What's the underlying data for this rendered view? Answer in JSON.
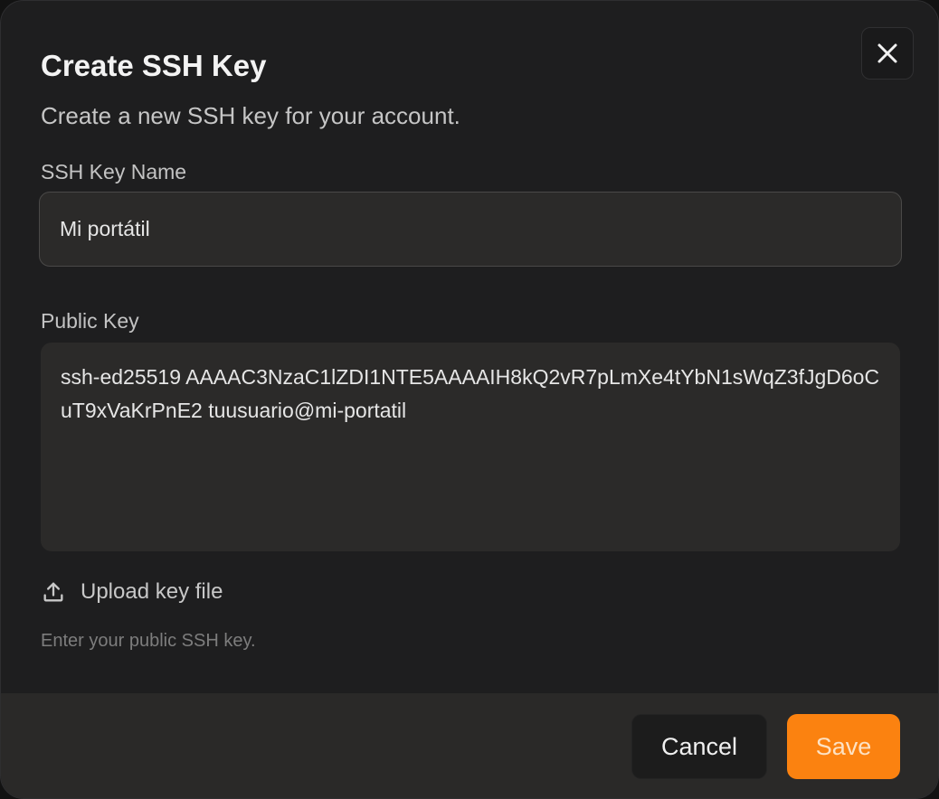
{
  "dialog": {
    "title": "Create SSH Key",
    "subtitle": "Create a new SSH key for your account.",
    "close_icon": "close-icon"
  },
  "form": {
    "name_label": "SSH Key Name",
    "name_value": "Mi portátil",
    "key_label": "Public Key",
    "key_value": "ssh-ed25519 AAAAC3NzaC1lZDI1NTE5AAAAIH8kQ2vR7pLmXe4tYbN1sWqZ3fJgD6oCuT9xVaKrPnE2 tuusuario@mi-portatil",
    "upload_icon": "upload-icon",
    "upload_label": "Upload key file",
    "hint": "Enter your public SSH key."
  },
  "footer": {
    "cancel_label": "Cancel",
    "save_label": "Save"
  },
  "colors": {
    "accent": "#fb8210",
    "background": "#1e1e1f",
    "input_background": "#2b2a29",
    "footer_background": "#2a2928"
  }
}
